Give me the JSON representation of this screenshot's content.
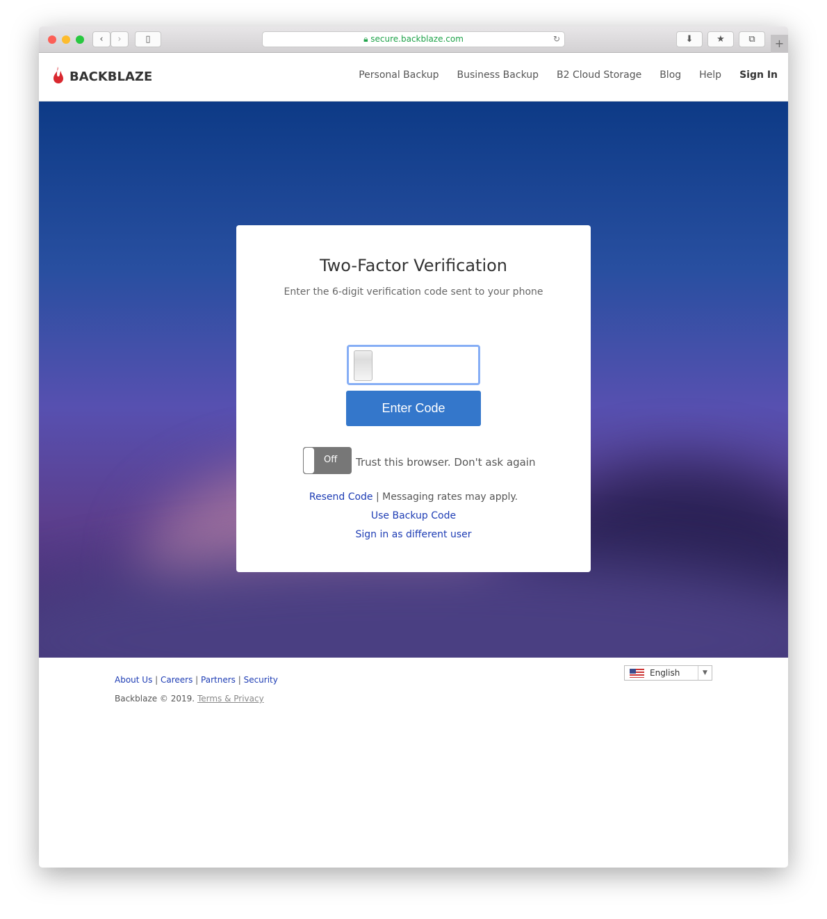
{
  "browser": {
    "url": "secure.backblaze.com"
  },
  "nav": {
    "brand": "BACKBLAZE",
    "items": [
      "Personal Backup",
      "Business Backup",
      "B2 Cloud Storage",
      "Blog",
      "Help"
    ],
    "sign_in": "Sign In"
  },
  "card": {
    "title": "Two-Factor Verification",
    "subtitle": "Enter the 6-digit verification code sent to your phone",
    "code_value": "",
    "button": "Enter Code",
    "toggle_state": "Off",
    "trust_label": "Trust this browser. Don't ask again",
    "resend": "Resend Code",
    "separator": "|",
    "rates": "Messaging rates may apply.",
    "backup": "Use Backup Code",
    "different_user": "Sign in as different user"
  },
  "footer": {
    "links": [
      "About Us",
      "Careers",
      "Partners",
      "Security"
    ],
    "copyright": "Backblaze © 2019.",
    "terms": "Terms & Privacy",
    "language": "English"
  },
  "colors": {
    "primary": "#3477cb",
    "link": "#1d3cb4",
    "brand": "#d9282f"
  }
}
